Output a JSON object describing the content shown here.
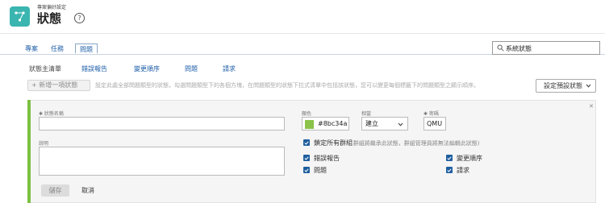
{
  "header": {
    "breadcrumb": "專案偏好設定",
    "title": "狀態",
    "help_label": "?"
  },
  "tabs": [
    {
      "label": "專案"
    },
    {
      "label": "任務"
    },
    {
      "label": "問題",
      "active": true
    }
  ],
  "search": {
    "value": "系統狀態"
  },
  "subtabs": [
    {
      "label": "狀態主清單",
      "active": true
    },
    {
      "label": "錯誤報告"
    },
    {
      "label": "變更順序"
    },
    {
      "label": "問題"
    },
    {
      "label": "請求"
    }
  ],
  "toolbar": {
    "new_button": "+ 新增一項狀態",
    "hint": "設定此處全部問題類型的狀態，勾選問題類型下的各個方塊，在問題類型的狀態下拉式清單中包括該狀態，您可以變更每個標籤下的問題類型之顯示順序。",
    "preset_button": "設定預設狀態"
  },
  "form": {
    "name_label": "✱ 狀態名稱",
    "name_value": "",
    "description_label": "說明",
    "color_label": "顏色",
    "color_value": "#8bc34a",
    "color_hex": "#8bc34a",
    "equals_label": "相當",
    "equals_value": "建立",
    "code_label": "✱ 密碼",
    "code_value": "QMU",
    "lock_all_label": "鎖定所有群組",
    "lock_all_hint": "(群組將繼承此狀態，群組管理員將無法編輯此狀態)",
    "issue_types": [
      "錯誤報告",
      "變更順序",
      "問題",
      "請求"
    ],
    "save_button": "儲存",
    "cancel_button": "取消"
  }
}
